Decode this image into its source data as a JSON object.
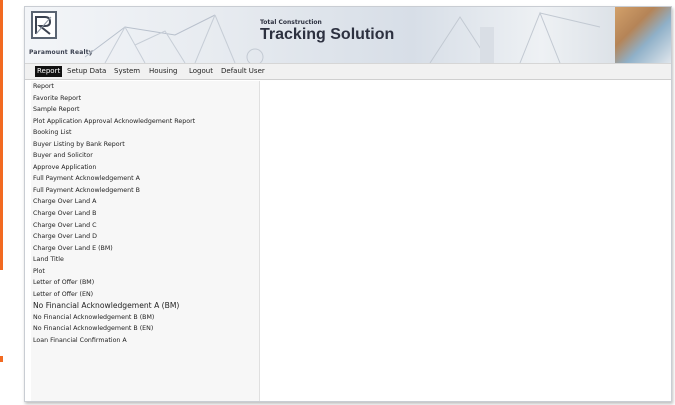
{
  "header": {
    "company": "Paramount Realty",
    "subtitle": "Total Construction",
    "title": "Tracking Solution"
  },
  "menubar": {
    "items": [
      "Report",
      "Setup Data",
      "System",
      "Housing",
      "Logout"
    ],
    "active": "Report",
    "user": "Default User"
  },
  "sidebar": {
    "items": [
      "Report",
      "Favorite Report",
      "Sample Report",
      "Plot Application Approval Acknowledgement Report",
      "Booking List",
      "Buyer Listing by Bank Report",
      "Buyer and Solicitor",
      "Approve Application",
      "Full Payment Acknowledgement A",
      "Full Payment Acknowledgement B",
      "Charge Over Land A",
      "Charge Over Land B",
      "Charge Over Land C",
      "Charge Over Land D",
      "Charge Over Land E (BM)",
      "Land Title",
      "Plot",
      "Letter of Offer (BM)",
      "Letter of Offer (EN)",
      "No Financial Acknowledgement A (BM)",
      "No Financial Acknowledgement B (BM)",
      "No Financial Acknowledgement B (EN)",
      "Loan Financial Confirmation A"
    ]
  },
  "colors": {
    "accent": "#f26a21",
    "active_menu": "#111111"
  }
}
